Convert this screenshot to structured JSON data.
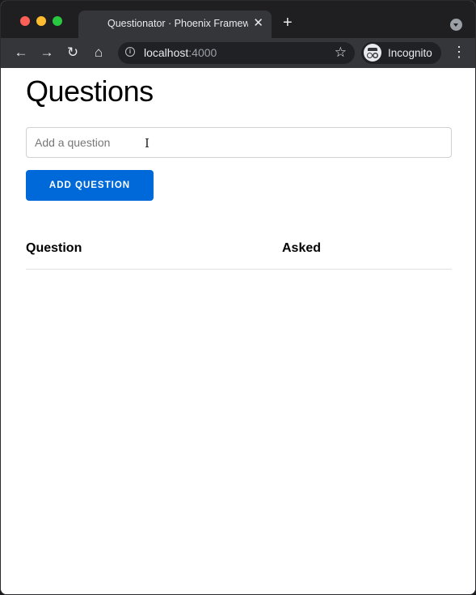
{
  "browser": {
    "tab_title": "Questionator · Phoenix Framework",
    "tab_close": "✕",
    "new_tab": "+",
    "url_host": "localhost",
    "url_port": ":4000",
    "profile_label": "Incognito",
    "icons": [
      "back-icon",
      "forward-icon",
      "reload-icon",
      "home-icon",
      "info-icon",
      "star-icon",
      "incognito-icon",
      "menu-icon"
    ]
  },
  "page": {
    "heading": "Questions",
    "question_input": {
      "value": "",
      "placeholder": "Add a question"
    },
    "add_button_label": "ADD QUESTION",
    "table": {
      "headers": [
        "Question",
        "Asked"
      ],
      "rows": []
    }
  },
  "colors": {
    "accent": "#0069d9"
  }
}
